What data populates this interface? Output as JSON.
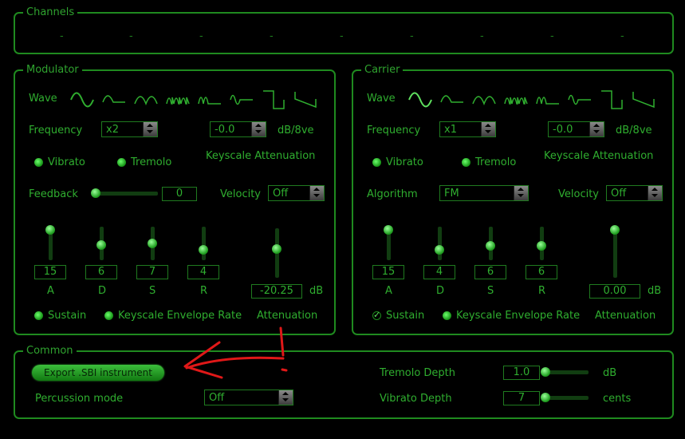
{
  "channels": {
    "title": "Channels",
    "slots": [
      "-",
      "-",
      "-",
      "-",
      "-",
      "-",
      "-",
      "-",
      "-"
    ]
  },
  "modulator": {
    "title": "Modulator",
    "wave_label": "Wave",
    "frequency_label": "Frequency",
    "frequency_value": "x2",
    "keyscale_value": "-0.0",
    "keyscale_unit": "dB/8ve",
    "keyscale_label": "Keyscale Attenuation",
    "vibrato_label": "Vibrato",
    "tremolo_label": "Tremolo",
    "feedback_label": "Feedback",
    "feedback_value": "0",
    "velocity_label": "Velocity",
    "velocity_value": "Off",
    "adsr": [
      {
        "label": "A",
        "value": "15"
      },
      {
        "label": "D",
        "value": "6"
      },
      {
        "label": "S",
        "value": "7"
      },
      {
        "label": "R",
        "value": "4"
      }
    ],
    "attenuation_value": "-20.25",
    "attenuation_unit": "dB",
    "attenuation_label": "Attenuation",
    "sustain_label": "Sustain",
    "ksr_label": "Keyscale Envelope Rate"
  },
  "carrier": {
    "title": "Carrier",
    "wave_label": "Wave",
    "frequency_label": "Frequency",
    "frequency_value": "x1",
    "keyscale_value": "-0.0",
    "keyscale_unit": "dB/8ve",
    "keyscale_label": "Keyscale Attenuation",
    "vibrato_label": "Vibrato",
    "tremolo_label": "Tremolo",
    "algorithm_label": "Algorithm",
    "algorithm_value": "FM",
    "velocity_label": "Velocity",
    "velocity_value": "Off",
    "adsr": [
      {
        "label": "A",
        "value": "15"
      },
      {
        "label": "D",
        "value": "4"
      },
      {
        "label": "S",
        "value": "6"
      },
      {
        "label": "R",
        "value": "6"
      }
    ],
    "attenuation_value": "0.00",
    "attenuation_unit": "dB",
    "attenuation_label": "Attenuation",
    "sustain_label": "Sustain",
    "ksr_label": "Keyscale Envelope Rate"
  },
  "common": {
    "title": "Common",
    "export_button": "Export .SBI instrument",
    "percussion_label": "Percussion mode",
    "percussion_value": "Off",
    "tremolo_depth_label": "Tremolo Depth",
    "tremolo_depth_value": "1.0",
    "tremolo_depth_unit": "dB",
    "vibrato_depth_label": "Vibrato Depth",
    "vibrato_depth_value": "7",
    "vibrato_depth_unit": "cents"
  },
  "colors": {
    "accent": "#2fae2f",
    "border": "#1f8a1f",
    "annotation": "#e01818"
  }
}
